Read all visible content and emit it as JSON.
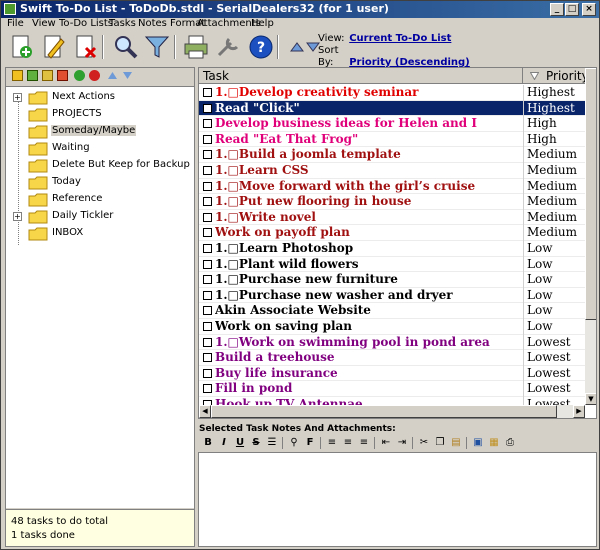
{
  "window": {
    "title": "Swift To-Do List - ToDoDb.stdl - SerialDealers32 (for 1 user)"
  },
  "menu": [
    "File",
    "View",
    "To-Do Lists",
    "Tasks",
    "Notes Format",
    "Attachments",
    "Help"
  ],
  "view_info": {
    "view_label": "View:",
    "view_value": "Current To-Do List",
    "sort_label": "Sort By:",
    "sort_value": "Priority (Descending)"
  },
  "tree": [
    {
      "label": "Next Actions",
      "expandable": true
    },
    {
      "label": "PROJECTS",
      "expandable": false
    },
    {
      "label": "Someday/Maybe",
      "expandable": false,
      "selected": true
    },
    {
      "label": "Waiting",
      "expandable": false
    },
    {
      "label": "Delete But Keep for Backup",
      "expandable": false
    },
    {
      "label": "Today",
      "expandable": false
    },
    {
      "label": "Reference",
      "expandable": false
    },
    {
      "label": "Daily Tickler",
      "expandable": true
    },
    {
      "label": "INBOX",
      "expandable": false
    }
  ],
  "status": {
    "line1": "48 tasks to do total",
    "line2": "1 tasks done"
  },
  "grid": {
    "col_task": "Task",
    "col_priority": "Priority"
  },
  "tasks": [
    {
      "task": "1.□Develop creativity seminar",
      "priority": "Highest",
      "color": "#e00000"
    },
    {
      "task": "Read \"Click\"",
      "priority": "Highest",
      "color": "#e00000",
      "selected": true
    },
    {
      "task": "Develop business ideas for Helen and I",
      "priority": "High",
      "color": "#e0007a"
    },
    {
      "task": "Read \"Eat That Frog\"",
      "priority": "High",
      "color": "#e0007a"
    },
    {
      "task": "1.□Build a joomla template",
      "priority": "Medium",
      "color": "#a01010"
    },
    {
      "task": "1.□Learn CSS",
      "priority": "Medium",
      "color": "#a01010"
    },
    {
      "task": "1.□Move forward with the girl’s cruise",
      "priority": "Medium",
      "color": "#a01010"
    },
    {
      "task": "1.□Put new flooring in house",
      "priority": "Medium",
      "color": "#a01010"
    },
    {
      "task": "1.□Write novel",
      "priority": "Medium",
      "color": "#a01010"
    },
    {
      "task": "Work on payoff plan",
      "priority": "Medium",
      "color": "#a01010"
    },
    {
      "task": "1.□Learn Photoshop",
      "priority": "Low",
      "color": "#000000"
    },
    {
      "task": "1.□Plant wild flowers",
      "priority": "Low",
      "color": "#000000"
    },
    {
      "task": "1.□Purchase new furniture",
      "priority": "Low",
      "color": "#000000"
    },
    {
      "task": "1.□Purchase new washer and dryer",
      "priority": "Low",
      "color": "#000000"
    },
    {
      "task": "Akin Associate Website",
      "priority": "Low",
      "color": "#000000"
    },
    {
      "task": "Work on saving plan",
      "priority": "Low",
      "color": "#000000"
    },
    {
      "task": "1.□Work on swimming pool in pond area",
      "priority": "Lowest",
      "color": "#800080"
    },
    {
      "task": "Build a treehouse",
      "priority": "Lowest",
      "color": "#800080"
    },
    {
      "task": "Buy life insurance",
      "priority": "Lowest",
      "color": "#800080"
    },
    {
      "task": "Fill in pond",
      "priority": "Lowest",
      "color": "#800080"
    },
    {
      "task": "Hook up TV Antennae",
      "priority": "Lowest",
      "color": "#800080"
    }
  ],
  "notes": {
    "label": "Selected Task Notes And Attachments:",
    "bold": "B",
    "italic": "I",
    "underline": "U",
    "strike": "S",
    "font": "F"
  }
}
